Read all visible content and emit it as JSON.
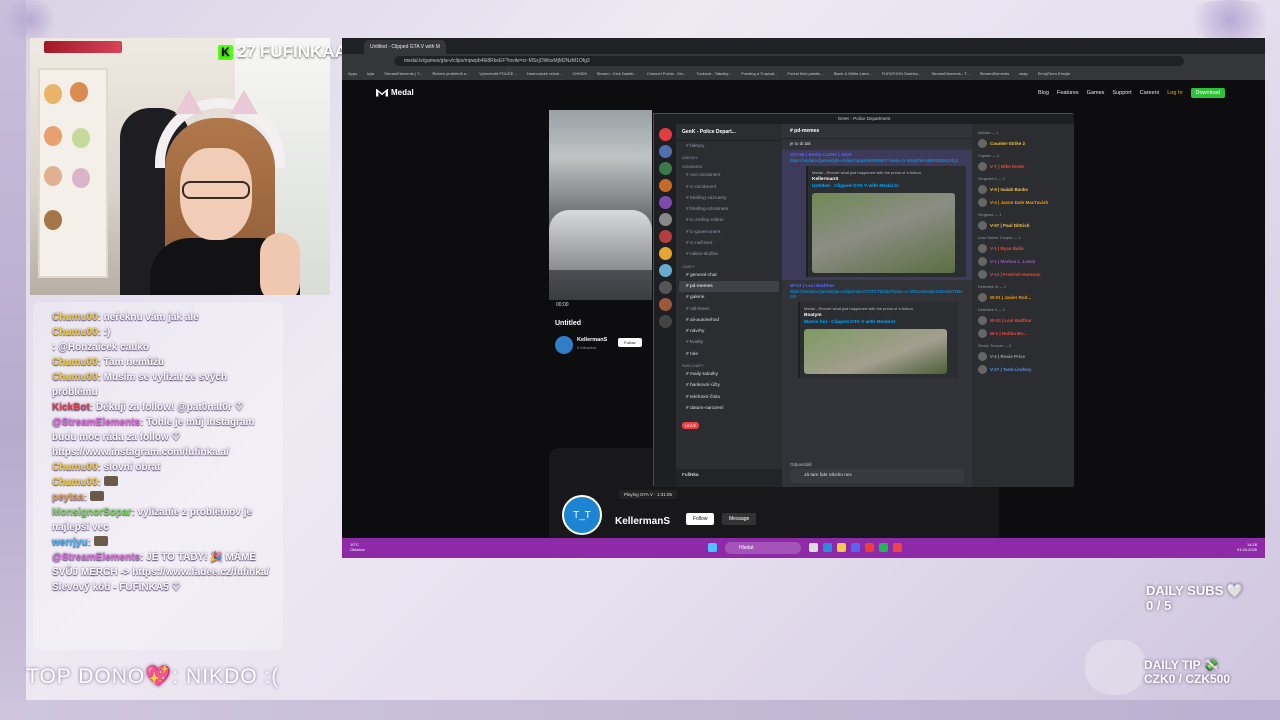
{
  "overlay": {
    "sub_count": "27",
    "kick_badge": "K",
    "channel_name": "FUFINKAA",
    "top_dono": "TOP DONO💖: NIKDO :(",
    "daily_subs_label": "DAILY SUBS 🤍",
    "daily_subs_value": "0 / 5",
    "daily_tip_label": "DAILY TIP 💸",
    "daily_tip_value": "CZK0 / CZK500"
  },
  "chat": [
    {
      "user": "Chumu00",
      "color": "#f3d23a",
      "text": "neřeknu vám jak ale"
    },
    {
      "user": "Chumu00",
      "color": "#f3d23a",
      "text": ":)"
    },
    {
      "user": "",
      "color": "#4db4e6",
      "text": "@Honzaicek cauko"
    },
    {
      "user": "Chumu00",
      "color": "#f3d23a",
      "text": "Tam nemůžu"
    },
    {
      "user": "Chumu00",
      "color": "#f3d23a",
      "text": "Musím se vylízat ze svých problému"
    },
    {
      "user": "KickBot",
      "color": "#e8383e",
      "text": "Děkuji za follow! @pat0nat0r ♡"
    },
    {
      "user": "@StreamElements",
      "color": "#e26bd8",
      "text": "Tohle je můj Instagram budu moc ráda za follow ♡ https://www.instagram.com/fufinka.a/"
    },
    {
      "user": "Chumu00",
      "color": "#f3d23a",
      "text": "slovní obrat"
    },
    {
      "user": "Chumu00",
      "color": "#f3d23a",
      "text": ""
    },
    {
      "user": "peytaa",
      "color": "#e2a43a",
      "text": ""
    },
    {
      "user": "MonsignorSopar",
      "color": "#7fdc5c",
      "text": "vylízanie z problémov je najlepší vec"
    },
    {
      "user": "werrjyu",
      "color": "#4db4e6",
      "text": ""
    },
    {
      "user": "@StreamElements",
      "color": "#e26bd8",
      "text": "JE TO TADY! 🎉 MÁME SVŮJ MERCH -> https://www.fadee.cz/fufinka/ Slevový kód - FUFINKA5 ♡"
    }
  ],
  "browser": {
    "tab_title": "Untitled - Clipped GTA V with M",
    "url": "medal.tv/games/gta-v/clips/mpwpb46i8RkeEF?invite=cr-MSxjOWoxMjM2NzM1Ofg3",
    "bookmarks": [
      "Apps",
      "kyla",
      "StreamElements | T...",
      "Řešení problémů s...",
      "Vyhodnotit POUČE...",
      "Harmonické rekotí...",
      "CHMD5",
      "Stream - Kick Dashb...",
      "Channel Points - Kic...",
      "Tonková - Tabulky...",
      "Pointing a Tropical...",
      "Forest field paintin...",
      "Black & White Land...",
      "FUFATHON Dashbo...",
      "StreamElements - T...",
      "StreamElements",
      "ssap",
      "EmojiTerra Emojis"
    ]
  },
  "medal": {
    "brand": "Medal",
    "nav": [
      "Blog",
      "Features",
      "Games",
      "Support",
      "Careers"
    ],
    "login": "Log In",
    "download": "Download",
    "video_time": "00:00",
    "clip_title": "Untitled",
    "user": "KellermanS",
    "followers": "0 followers",
    "follow": "Follow",
    "message": "Message",
    "playing": "Playing GTA V",
    "playing_time": "1:31:05",
    "avatar_face": "T_T"
  },
  "discord": {
    "window_title": "GenK - Police Department",
    "guild": "GenK - Police Depart...",
    "channel_header": "pd-memes",
    "categories": [
      "ZÁKONY",
      "OZNÁMENÍ",
      "CHATY",
      "SUB-CHATY"
    ],
    "channels_top": [
      "faktury"
    ],
    "channels_notice": [
      "ooc-oznámení",
      "ic-oznámení",
      "briefing-záznamy",
      "briefing-oznámení",
      "ic-změny-zákon",
      "ic-government",
      "ic-nařízení",
      "nábor-služba"
    ],
    "channels_chat": [
      "general-chat",
      "pd-memes",
      "galerie",
      "old-times",
      "ali-autonehod",
      "návrhy",
      "kvality",
      "role"
    ],
    "channels_sub": [
      "maily-tabulky",
      "bankovní-účty",
      "telefonní-čísla",
      "datum-narození"
    ],
    "new_badge": "NOVÉ",
    "user_name": "FufiNka",
    "messages": {
      "line_top": "je to dr.tak",
      "author1": "@V-66 | Emily Carter | 1505",
      "link1": "https://medal.tv/games/gta-v/clips/mpwpb46i8RkeEF?invite=cr-MSxjOWoxMjM2NzM1Ofg3",
      "embed1_meta": "Medal - Record what just happened with the press of a button",
      "embed1_author": "KellermanS",
      "embed1_title": "Untitled - Clipped GTA V with Medal.tv",
      "author2": "W-03 | Lexi Badthar",
      "link2": "https://medal.tv/games/gta-v/clips/mdrecl7OTCT6iUbd?invite=cr-MSxJaiKsMjAzNDcwNTk5Nzr9",
      "embed2_meta": "Medal - Record what just happened with the press of a button",
      "embed2_author": "Boatym",
      "embed2_title": "Marno hol - Clipped GTA V with Medal.tv",
      "reply_label": "Odpovídáš",
      "input_text": "Já tam fakt nikoho nec"
    },
    "member_groups": [
      {
        "header": "Aktivita — 1",
        "members": [
          {
            "name": "Counter-Strike 2",
            "cls": ""
          }
        ]
      },
      {
        "header": "Captain — 1",
        "members": [
          {
            "name": "V-T | Mike Drake",
            "cls": "r"
          }
        ]
      },
      {
        "header": "Sergeant II — 2",
        "members": [
          {
            "name": "V-3 | Isaiah Banks",
            "cls": ""
          },
          {
            "name": "V-4 | Jason Dale MacTavish",
            "cls": "o"
          }
        ]
      },
      {
        "header": "Sergeant — 1",
        "members": [
          {
            "name": "V-07 | Paul Dittrich",
            "cls": ""
          }
        ]
      },
      {
        "header": "Lead Senior Trooper — 1",
        "members": [
          {
            "name": "V-1 | Ryan Ballo",
            "cls": "r"
          },
          {
            "name": "V-1 | Markus L. Lewis",
            "cls": "pu"
          },
          {
            "name": "V-12 | Fredrich Hartman",
            "cls": "r"
          }
        ]
      },
      {
        "header": "Detective III — 1",
        "members": [
          {
            "name": "W-01 | Javier Rod...",
            "cls": "o"
          }
        ]
      },
      {
        "header": "Detective II — 2",
        "members": [
          {
            "name": "W-03 | Lexi Badthar",
            "cls": "r"
          },
          {
            "name": "W-1 | Hubba Bo...",
            "cls": "r"
          }
        ]
      },
      {
        "header": "Senior Trooper — 2",
        "members": [
          {
            "name": "V-2 | Rosie Price",
            "cls": "gr"
          },
          {
            "name": "V-27 | Tank Lindsey",
            "cls": "bl"
          }
        ]
      }
    ]
  },
  "taskbar": {
    "weather": "10°C",
    "weather_sub": "Oblačno",
    "search": "Hledat",
    "time": "14:28",
    "date": "01.04.2026"
  }
}
